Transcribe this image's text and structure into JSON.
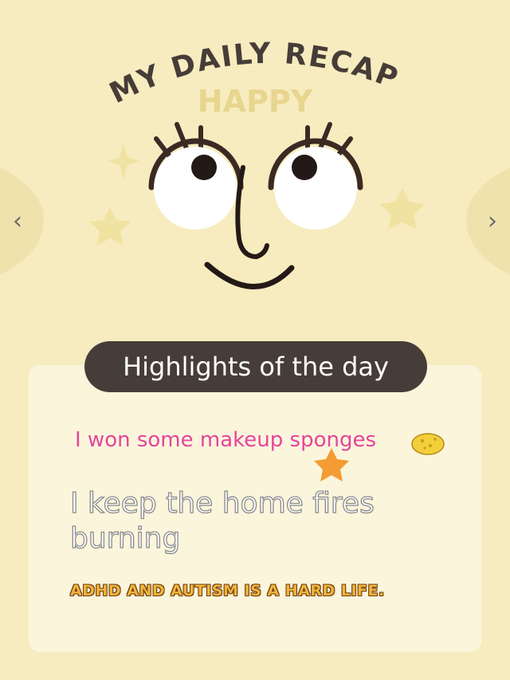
{
  "header": {
    "title": "MY DAILY RECAP",
    "mood": "HAPPY"
  },
  "nav": {
    "prev_icon": "chevron-left-icon",
    "next_icon": "chevron-right-icon",
    "prev_glyph": "‹",
    "next_glyph": "›"
  },
  "highlights": {
    "heading": "Highlights of the day",
    "items": [
      "I won some makeup sponges",
      "I keep the home fires burning",
      "ADHD AND AUTISM IS A HARD LIFE."
    ]
  },
  "colors": {
    "background": "#f7ecbf",
    "title": "#463d38",
    "mood": "#e8d58e",
    "pill": "#463d38",
    "pink_text": "#e6459b",
    "star": "#f0e2a0",
    "orange_star": "#f39c34",
    "sponge": "#f2cf3a"
  }
}
